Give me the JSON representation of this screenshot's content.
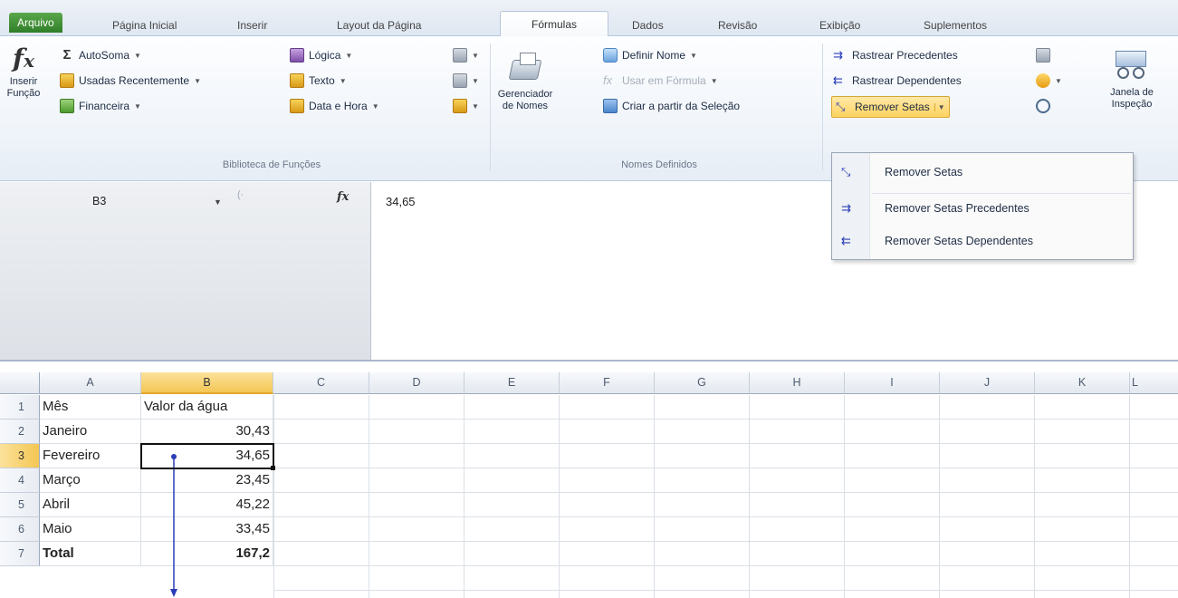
{
  "tabs": [
    "Arquivo",
    "Página Inicial",
    "Inserir",
    "Layout da Página",
    "Fórmulas",
    "Dados",
    "Revisão",
    "Exibição",
    "Suplementos"
  ],
  "ribbon": {
    "insert_function": {
      "line1": "Inserir",
      "line2": "Função"
    },
    "library": {
      "autosum": "AutoSoma",
      "recent": "Usadas Recentemente",
      "financial": "Financeira",
      "logic": "Lógica",
      "text": "Texto",
      "datetime": "Data e Hora",
      "label": "Biblioteca de Funções"
    },
    "names": {
      "manager_line1": "Gerenciador",
      "manager_line2": "de Nomes",
      "define": "Definir Nome",
      "use_in_formula": "Usar em Fórmula",
      "create_from_selection": "Criar a partir da Seleção",
      "label": "Nomes Definidos"
    },
    "audit": {
      "trace_precedents": "Rastrear Precedentes",
      "trace_dependents": "Rastrear Dependentes",
      "remove_arrows": "Remover Setas"
    },
    "watch": {
      "line1": "Janela de",
      "line2": "Inspeção"
    }
  },
  "menu": {
    "items": [
      "Remover Setas",
      "Remover Setas Precedentes",
      "Remover Setas Dependentes"
    ]
  },
  "formula_bar": {
    "name_box": "B3",
    "fx": "fx",
    "formula": "34,65"
  },
  "sheet": {
    "columns": [
      "A",
      "B",
      "C",
      "D",
      "E",
      "F",
      "G",
      "H",
      "I",
      "J",
      "K",
      "L"
    ],
    "rows": [
      {
        "num": "1",
        "a": "Mês",
        "b": "Valor da água"
      },
      {
        "num": "2",
        "a": "Janeiro",
        "b": "30,43"
      },
      {
        "num": "3",
        "a": "Fevereiro",
        "b": "34,65"
      },
      {
        "num": "4",
        "a": "Março",
        "b": "23,45"
      },
      {
        "num": "5",
        "a": "Abril",
        "b": "45,22"
      },
      {
        "num": "6",
        "a": "Maio",
        "b": "33,45"
      },
      {
        "num": "7",
        "a": "Total",
        "b": "167,2"
      }
    ],
    "selected_cell": "B3"
  },
  "colors": {
    "file_tab": "#3a8a30",
    "selection_header": "#f4c653",
    "tracer_arrow": "#2c3db8"
  }
}
